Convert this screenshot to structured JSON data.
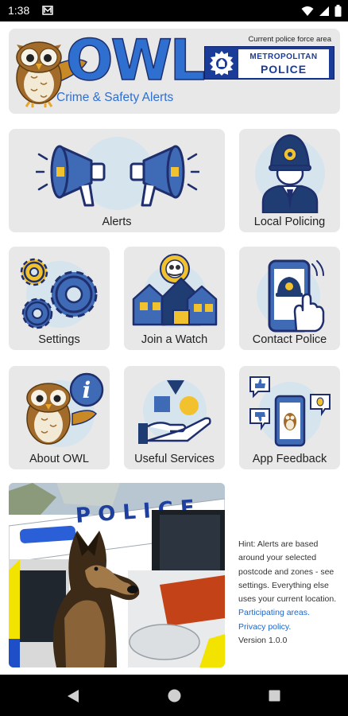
{
  "status_bar": {
    "time": "1:38"
  },
  "header": {
    "app_name": "OWL",
    "tagline": "Crime & Safety Alerts",
    "force_label": "Current police force area",
    "force_line1": "METROPOLITAN",
    "force_line2": "POLICE"
  },
  "tiles": {
    "alerts": "Alerts",
    "local_policing": "Local Policing",
    "settings": "Settings",
    "join_watch": "Join a Watch",
    "contact_police": "Contact Police",
    "about": "About OWL",
    "useful_services": "Useful Services",
    "app_feedback": "App Feedback"
  },
  "photo": {
    "car_text": "POLICE"
  },
  "hint": {
    "text": "Hint: Alerts are based around your selected postcode and zones - see settings. Everything else uses your current location.",
    "participating_link": "Participating areas.",
    "privacy_link": "Privacy policy.",
    "version": "Version 1.0.0"
  },
  "colors": {
    "accent_blue": "#2f6fd0",
    "dark_navy": "#1f2f6d",
    "tile_bg": "#e8e8e8",
    "met_blue": "#1a3b98"
  }
}
